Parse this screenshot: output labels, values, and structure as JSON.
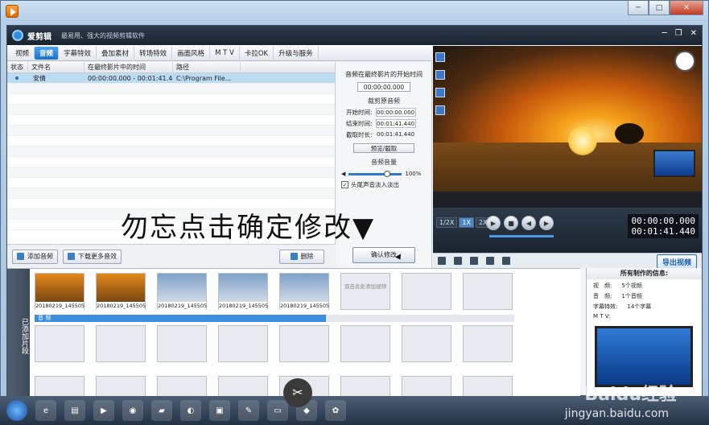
{
  "menu": {
    "items": [
      "视频",
      "音频",
      "字幕特效",
      "叠加素材",
      "转场特效",
      "画面风格",
      "M T V",
      "卡拉OK",
      "升级与服务"
    ]
  },
  "app": {
    "title": "爱剪辑",
    "subtitle": "最易用、强大的视频剪辑软件"
  },
  "table": {
    "headers": [
      "状态",
      "文件名",
      "在最终影片中的时间",
      "路径"
    ],
    "rows": [
      {
        "name": "安倩",
        "time": "00:00:00.000 - 00:01:41.440",
        "path": "C:\\Program File..."
      }
    ]
  },
  "buttons": {
    "add_audio": "添加音频",
    "download": "下载更多音效",
    "delete": "删除",
    "confirm": "确认修改",
    "export": "导出视频"
  },
  "audio_panel": {
    "start_label": "音频在最终影片的开始时间",
    "start_value": "00:00:00.000",
    "clip_section": "裁剪原音频",
    "start_time_label": "开始时间:",
    "start_time": "00:00:00.000",
    "end_time_label": "结束时间:",
    "end_time": "00:01:41.440",
    "duration_label": "截取时长:",
    "duration": "00:01:41.440",
    "preview_btn": "预览/截取",
    "volume_section": "音频音量",
    "volume": "100%",
    "fade_label": "头尾声音淡入淡出"
  },
  "player": {
    "speeds": [
      "1/2X",
      "1X",
      "2X"
    ],
    "time_current": "00:00:00.000",
    "time_total": "00:01:41.440"
  },
  "timeline": {
    "side_label": "已添加片段",
    "clips": [
      "20180219_145505",
      "20180219_145505",
      "20180219_145505",
      "20180219_145505",
      "20180219_145505"
    ],
    "empty_hint": "双击此处添加视频",
    "audio_label": "音 频"
  },
  "info": {
    "title": "所有制作的信息:",
    "rows": [
      {
        "k": "视　频:",
        "v": "5个视频"
      },
      {
        "k": "音　频:",
        "v": "1个音频"
      },
      {
        "k": "字幕特效:",
        "v": "14个字幕"
      },
      {
        "k": "M T V:",
        "v": ""
      }
    ]
  },
  "overlay_text": "勿忘点击确定修改▼",
  "watermark": {
    "main": "Baidu经验",
    "sub": "jingyan.baidu.com"
  }
}
